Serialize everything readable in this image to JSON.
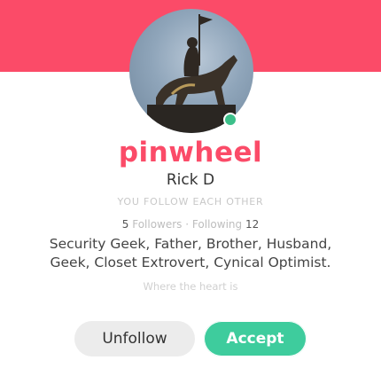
{
  "profile": {
    "username": "pinwheel",
    "display_name": "Rick D",
    "follow_note": "YOU FOLLOW EACH OTHER",
    "followers_count": "5",
    "followers_label": "Followers",
    "separator": "·",
    "following_label": "Following",
    "following_count": "12",
    "bio": "Security Geek, Father, Brother, Husband, Geek, Closet Extrovert, Cynical Optimist.",
    "location": "Where the heart is",
    "online": true
  },
  "actions": {
    "unfollow_label": "Unfollow",
    "accept_label": "Accept"
  },
  "colors": {
    "brand": "#fb4b68",
    "accept": "#3ecc9d",
    "online": "#3cc08a"
  }
}
